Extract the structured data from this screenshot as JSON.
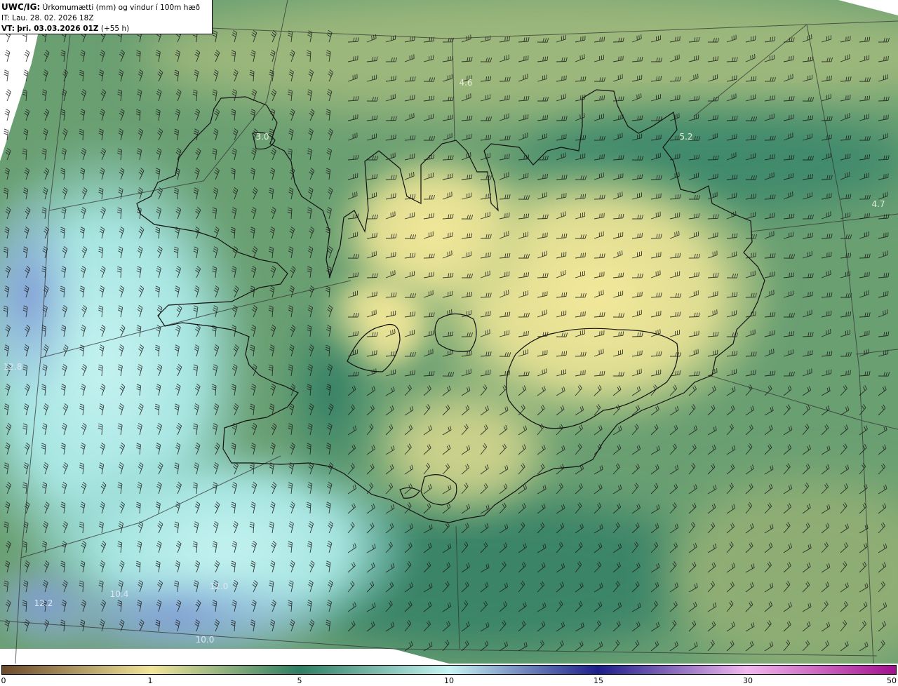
{
  "info": {
    "title_bold": "UWC/IG:",
    "title_rest": "Úrkomumætti (mm) og vindur í 100m hæð",
    "it_line": "IT: Lau. 28. 02. 2026 18Z",
    "vt_label": "VT:",
    "vt_time": "þri. 03.03.2026 01Z",
    "vt_offset": "(+55 h)"
  },
  "map": {
    "value_labels": [
      {
        "text": "4.6",
        "color": "#e8eed8"
      },
      {
        "text": "5.2",
        "color": "#e8eed8"
      },
      {
        "text": "4.7",
        "color": "#e8eed8"
      },
      {
        "text": "3.0",
        "color": "#e8eed8"
      },
      {
        "text": "12.8",
        "color": "#dde6f6"
      },
      {
        "text": "12.2",
        "color": "#dde6f6"
      },
      {
        "text": "12.0",
        "color": "#dde6f6"
      },
      {
        "text": "10.4",
        "color": "#dde6f6"
      },
      {
        "text": "10.0",
        "color": "#dde6f6"
      }
    ],
    "coastline_color": "#111111",
    "grid_color": "#333333"
  },
  "colorbar": {
    "ticks": [
      "0",
      "1",
      "5",
      "10",
      "15",
      "30",
      "50"
    ],
    "colors": [
      "#6b4a2b",
      "#f1e59a",
      "#2f7d63",
      "#c7f5f3",
      "#1d1d8a",
      "#f2b8ee",
      "#a2108f"
    ]
  }
}
